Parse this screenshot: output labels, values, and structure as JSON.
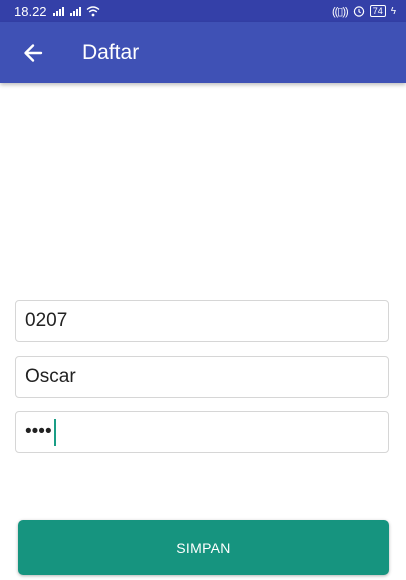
{
  "status_bar": {
    "time": "18.22",
    "battery": "74",
    "icons": [
      "signal-icon",
      "signal-icon",
      "wifi-icon",
      "vibrate-icon",
      "alarm-icon",
      "battery-icon",
      "charging-icon"
    ]
  },
  "app_bar": {
    "title": "Daftar",
    "back_icon": "arrow-back-icon",
    "background": "#3f51b5"
  },
  "form": {
    "id_value": "0207",
    "name_value": "Oscar",
    "password_value": "••••",
    "save_label": "SIMPAN"
  },
  "colors": {
    "status_bar": "#3440a8",
    "app_bar": "#3f51b5",
    "button": "#16947f",
    "cursor": "#1a9e86"
  }
}
